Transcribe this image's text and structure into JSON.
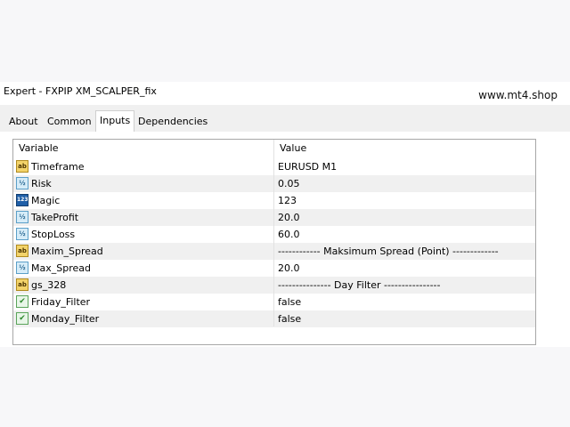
{
  "window": {
    "title": "Expert - FXPIP XM_SCALPER_fix",
    "watermark": "www.mt4.shop"
  },
  "tabs": [
    {
      "label": "About"
    },
    {
      "label": "Common"
    },
    {
      "label": "Inputs",
      "active": true
    },
    {
      "label": "Dependencies"
    }
  ],
  "table": {
    "columns": [
      "Variable",
      "Value"
    ],
    "rows": [
      {
        "variable": "Timeframe",
        "value": "EURUSD M1",
        "icon": "string-ab-icon"
      },
      {
        "variable": "Risk",
        "value": "0.05",
        "icon": "double-v12-icon"
      },
      {
        "variable": "Magic",
        "value": "123",
        "icon": "integer-123-icon"
      },
      {
        "variable": "TakeProfit",
        "value": "20.0",
        "icon": "double-v12-icon"
      },
      {
        "variable": "StopLoss",
        "value": "60.0",
        "icon": "double-v12-icon"
      },
      {
        "variable": "Maxim_Spread",
        "value": "------------ Maksimum Spread (Point) -------------",
        "icon": "string-ab-icon"
      },
      {
        "variable": "Max_Spread",
        "value": "20.0",
        "icon": "double-v12-icon"
      },
      {
        "variable": "gs_328",
        "value": "--------------- Day Filter ----------------",
        "icon": "string-ab-icon"
      },
      {
        "variable": "Friday_Filter",
        "value": "false",
        "icon": "bool-icon"
      },
      {
        "variable": "Monday_Filter",
        "value": "false",
        "icon": "bool-icon"
      }
    ]
  }
}
